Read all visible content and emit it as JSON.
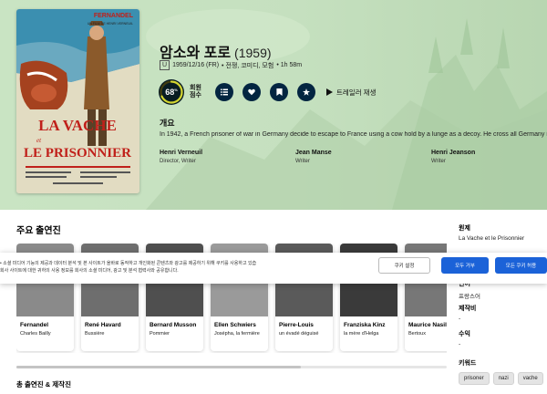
{
  "movie": {
    "title": "암소와 포로",
    "year": "(1959)",
    "certification": "U",
    "release": "1959/12/16 (FR)",
    "genres": "• 전쟁, 코미디, 모험",
    "runtime": "• 1h 58m",
    "user_score": "68",
    "score_percent_symbol": "%",
    "user_score_fraction": 0.68,
    "score_label_line1": "회원",
    "score_label_line2": "점수",
    "trailer_label": "트레일러 재생",
    "overview_heading": "개요",
    "overview": "In 1942, a French prisoner of war in Germany decide to escape to France using a cow hold by a lunge as a decoy. He cross all Germany in th"
  },
  "poster": {
    "top_name": "FERNANDEL",
    "subtitle": "UN FILM DE HENRI VERNEUIL",
    "title_line1": "LA VACHE",
    "title_line2": "et",
    "title_line3": "LE PRISONNIER"
  },
  "crew": [
    {
      "name": "Henri Verneuil",
      "role": "Director, Writer"
    },
    {
      "name": "Jean Manse",
      "role": "Writer"
    },
    {
      "name": "Henri Jeanson",
      "role": "Writer"
    }
  ],
  "cast_heading": "주요 출연진",
  "cast": [
    {
      "name": "Fernandel",
      "character": "Charles Bailly",
      "photo_color": "#8a8a8a"
    },
    {
      "name": "René Havard",
      "character": "Bussière",
      "photo_color": "#6e6e6e"
    },
    {
      "name": "Bernard Musson",
      "character": "Pommier",
      "photo_color": "#4f4f4f"
    },
    {
      "name": "Ellen Schwiers",
      "character": "Josépha, la fermière",
      "photo_color": "#9a9a9a"
    },
    {
      "name": "Pierre-Louis",
      "character": "un évadé déguisé",
      "photo_color": "#5a5a5a"
    },
    {
      "name": "Franziska Kinz",
      "character": "la mère d'Helga",
      "photo_color": "#3a3a3a"
    },
    {
      "name": "Maurice Nasil",
      "character": "Bertoux",
      "photo_color": "#777777"
    }
  ],
  "full_cast_link": "총 출연진 & 제작진",
  "facts": {
    "original_title_label": "원제",
    "original_title": "La Vache et le Prisonnier",
    "language_label": "언어",
    "language": "프랑스어",
    "budget_label": "제작비",
    "budget": "-",
    "revenue_label": "수익",
    "revenue": "-",
    "keywords_label": "키워드",
    "keywords": [
      "prisoner",
      "nazi",
      "vache"
    ]
  },
  "cookie": {
    "line1": "• 소셜 미디어 기능의 제공과 데이터 분석 및 본 사이트가 올바로 동작하고 개인화된 콘텐츠와 광고를 제공하기 위해 쿠키를 사용하고 있습",
    "line2": "회사 사이트에 대한 귀하의 사용 정보를 회사의 소셜 미디어, 광고 및 분석 협력사와 공유합니다.",
    "settings_button": "쿠키 설정",
    "reject_button": "모두 거부",
    "accept_button": "모든 쿠키 허용"
  },
  "colors": {
    "hero_bg": "#c6e1c0",
    "score_bg": "#081c22",
    "score_ring": "#d2d531",
    "action_button": "#032541",
    "cookie_primary": "#1b62d8"
  },
  "icons": {
    "list": "list-icon",
    "favorite": "heart-icon",
    "watchlist": "bookmark-icon",
    "rate": "star-icon",
    "trailer": "play-icon"
  }
}
